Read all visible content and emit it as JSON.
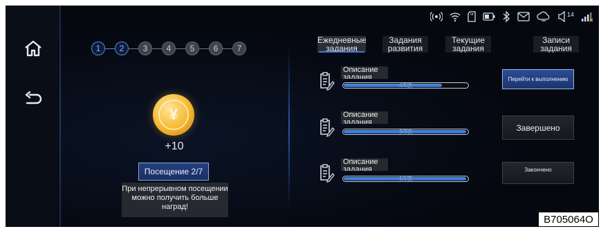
{
  "status_bar": {
    "icons": [
      "hotspot-icon",
      "wifi-icon",
      "sd-card-icon",
      "battery-icon",
      "bluetooth-icon",
      "mail-icon",
      "cloud-icon",
      "volume-icon",
      "signal-icon"
    ],
    "volume_level": "14"
  },
  "rail": {
    "icons": [
      "home-icon",
      "back-icon"
    ]
  },
  "stepper": {
    "steps": [
      "1",
      "2",
      "3",
      "4",
      "5",
      "6",
      "7"
    ],
    "current": 2
  },
  "reward": {
    "coin_symbol": "¥",
    "amount": "+10"
  },
  "visit_button": {
    "label": "Посещение 2/7"
  },
  "hint": {
    "text": "При непрерывном посещении можно получить больше наград!"
  },
  "tabs": [
    {
      "label": "Ежедневные задания"
    },
    {
      "label": "Задания развития"
    },
    {
      "label": "Текущие задания"
    },
    {
      "label": "Записи задания"
    }
  ],
  "selected_tab": 0,
  "tasks": [
    {
      "description": "Описание задания",
      "progress_text": "4/5次",
      "progress": 0.8,
      "action": "Перейти к выполнению"
    },
    {
      "description": "Описание задания",
      "progress_text": "3/3次",
      "progress": 1.0,
      "action": "Завершено"
    },
    {
      "description": "Описание задания",
      "progress_text": "1/1次",
      "progress": 1.0,
      "action": "Закончено"
    }
  ],
  "figure_code": "B705064O",
  "colors": {
    "accent": "#3f7be0",
    "coin": "#f5b830",
    "background": "#05080f"
  }
}
